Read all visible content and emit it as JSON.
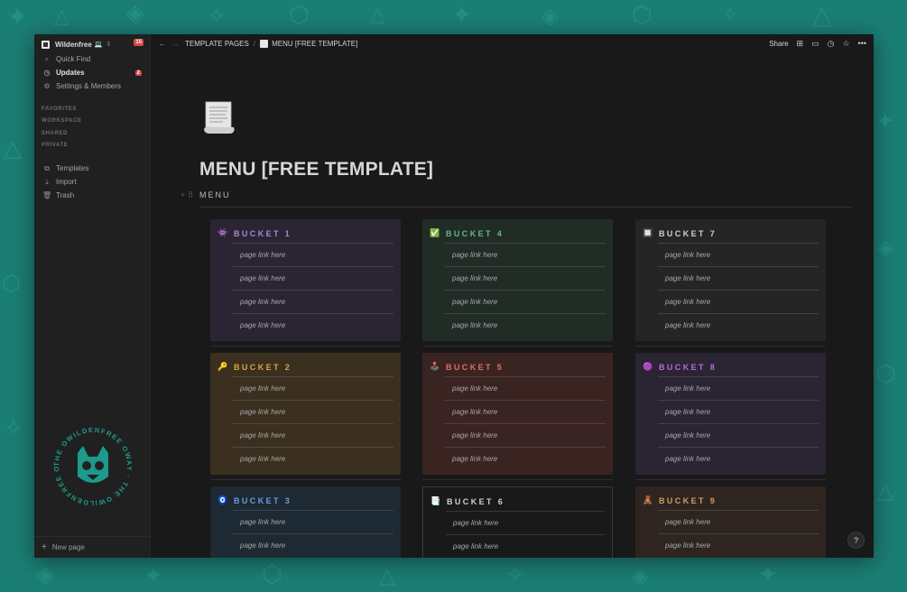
{
  "workspace": {
    "name": "Wildenfree",
    "notification_count": "15"
  },
  "sidebar": {
    "nav": [
      {
        "label": "Quick Find",
        "icon": "search-icon"
      },
      {
        "label": "Updates",
        "icon": "clock-icon",
        "badge": "2"
      },
      {
        "label": "Settings & Members",
        "icon": "gear-icon"
      }
    ],
    "sections": [
      "FAVORITES",
      "WORKSPACE",
      "SHARED",
      "PRIVATE"
    ],
    "tools": [
      {
        "label": "Templates",
        "icon": "templates-icon"
      },
      {
        "label": "Import",
        "icon": "download-icon"
      },
      {
        "label": "Trash",
        "icon": "trash-icon"
      }
    ],
    "new_page": "New page",
    "seal_text": "THE OWILDENFREE OWAY · THE OWILDENFREE OWAY ·"
  },
  "breadcrumb": {
    "parent": "TEMPLATE PAGES",
    "current": "MENU [FREE TEMPLATE]"
  },
  "topbar": {
    "share": "Share"
  },
  "page": {
    "title": "MENU [FREE TEMPLATE]",
    "subheading": "MENU"
  },
  "link_text": "page link here",
  "buckets": [
    {
      "title": "BUCKET 1",
      "emoji": "👾",
      "color": "#a58bd6",
      "bg": "#2b2433"
    },
    {
      "title": "BUCKET 4",
      "emoji": "✅",
      "color": "#63b684",
      "bg": "#212c26"
    },
    {
      "title": "BUCKET 7",
      "emoji": "🔲",
      "color": "#d0d0d0",
      "bg": "#252525"
    },
    {
      "title": "BUCKET 2",
      "emoji": "🔑",
      "color": "#d7a44a",
      "bg": "#3b2f1f"
    },
    {
      "title": "BUCKET 5",
      "emoji": "🕹️",
      "color": "#e06c64",
      "bg": "#3a2422"
    },
    {
      "title": "BUCKET 8",
      "emoji": "🟣",
      "color": "#b46ed9",
      "bg": "#2b2432"
    },
    {
      "title": "BUCKET 3",
      "emoji": "🧿",
      "color": "#6d9de0",
      "bg": "#1d2933"
    },
    {
      "title": "BUCKET 6",
      "emoji": "📑",
      "color": "#cfcfcf",
      "bg": "#191919"
    },
    {
      "title": "BUCKET 9",
      "emoji": "🧸",
      "color": "#d49a68",
      "bg": "#2f2520"
    }
  ],
  "help_label": "?"
}
